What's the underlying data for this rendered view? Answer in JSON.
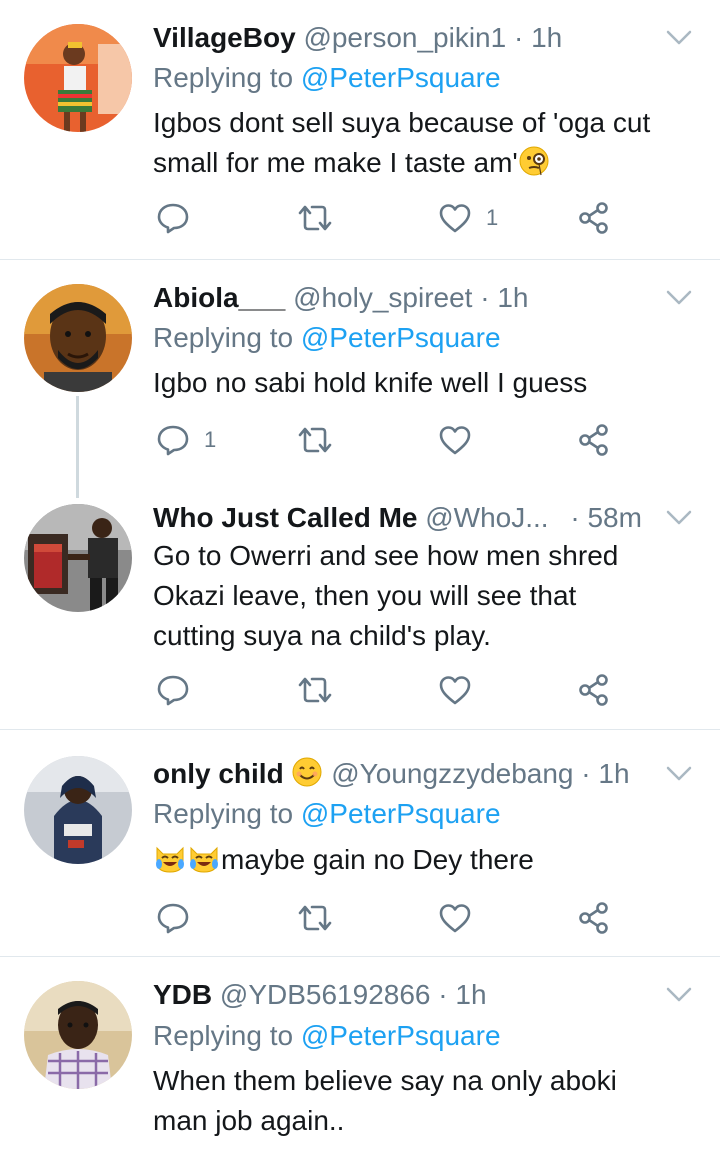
{
  "colors": {
    "link": "#1da1f2",
    "secondary_text": "#657786",
    "primary_text": "#14171a",
    "divider": "#e1e8ed"
  },
  "icons": {
    "reply": "reply-icon",
    "retweet": "retweet-icon",
    "like": "heart-icon",
    "share": "share-icon",
    "menu": "chevron-down-icon"
  },
  "tweets": [
    {
      "name": "VillageBoy",
      "handle": "@person_pikin1",
      "dot": "·",
      "time": "1h",
      "replying_prefix": "Replying to",
      "replying_to": "@PeterPsquare",
      "lines": [
        "Igbos dont sell suya because of 'oga cut",
        "small for me make I taste am'"
      ],
      "trailing_emoji": "face-with-monocle",
      "reply_count": "",
      "like_count": "1"
    },
    {
      "name": "Abiola___",
      "handle": "@holy_spireet",
      "dot": "·",
      "time": "1h",
      "replying_prefix": "Replying to",
      "replying_to": "@PeterPsquare",
      "lines": [
        "Igbo no sabi hold knife well I guess"
      ],
      "reply_count": "1",
      "like_count": ""
    },
    {
      "name": "Who Just Called Me",
      "handle": "@WhoJ...",
      "dot": "·",
      "time": "58m",
      "lines": [
        "Go to Owerri and see how men shred",
        "Okazi leave, then you will see that",
        "cutting suya na child's play."
      ],
      "reply_count": "",
      "like_count": ""
    },
    {
      "name": "only child",
      "name_emoji": "smiling-face",
      "handle": "@Youngzzydebang",
      "dot": "·",
      "time": "1h",
      "replying_prefix": "Replying to",
      "replying_to": "@PeterPsquare",
      "lead_emoji": "crying-laughing-cat x2",
      "lines": [
        "maybe gain no Dey there"
      ],
      "reply_count": "",
      "like_count": ""
    },
    {
      "name": "YDB",
      "handle": "@YDB56192866",
      "dot": "·",
      "time": "1h",
      "replying_prefix": "Replying to",
      "replying_to": "@PeterPsquare",
      "lines": [
        "When them believe say na only aboki",
        "man job again.."
      ],
      "reply_count": "",
      "like_count": ""
    }
  ]
}
